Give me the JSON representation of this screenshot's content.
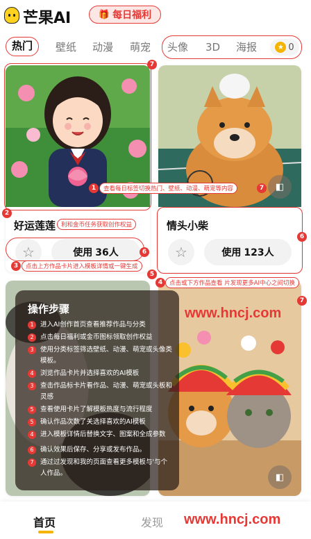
{
  "header": {
    "app_name": "芒果AI",
    "daily_label": "每日福利"
  },
  "tabs": [
    "热门",
    "壁纸",
    "动漫",
    "萌宠",
    "头像",
    "3D",
    "海报"
  ],
  "coin_count": "0",
  "cards": [
    {
      "title": "好运莲莲",
      "use_label": "使用",
      "use_count": "36人"
    },
    {
      "title": "情头小柴",
      "use_label": "使用",
      "use_count": "123人"
    }
  ],
  "tips": {
    "t1": "查看每日标签切换热门、壁纸、动漫、萌宠等内容",
    "t2": "利和金币任务获取创作权益",
    "t3": "点击上方作品卡片进入模板详情或一键生成",
    "t4": "点击或下方作品查看  片发现更多AI中心之间切换"
  },
  "badges": {
    "b1": "1",
    "b2": "2",
    "b3": "3",
    "b4": "4",
    "b5": "5",
    "b6": "6",
    "b7": "7"
  },
  "steps": {
    "title": "操作步骤",
    "items": [
      {
        "n": "1",
        "text": "进入AI创作首页查看推荐作品与分类"
      },
      {
        "n": "2",
        "text": "点击每日福利或金币图标领取创作权益"
      },
      {
        "n": "3",
        "text": "使用分类标签筛选壁纸、动漫、萌宠或头像类模板。"
      },
      {
        "n": "4",
        "text": "浏览作品卡片并选择喜欢的AI模板"
      },
      {
        "n": "3",
        "text": "查击作品标卡片看作品、动漫、萌宠或头板和灵感"
      },
      {
        "n": "5",
        "text": "查看使用卡片了解模板热度与流行程度"
      },
      {
        "n": "5",
        "text": "确认作品次数了关选择喜欢的AI模板"
      },
      {
        "n": "4",
        "text": "进入模板详情后替换文字、图案和全成参数"
      },
      {
        "n": "6",
        "text": "确认效果后保存、分享或发布作品。"
      },
      {
        "n": "7",
        "text": "通过过发现和我的页面查看更多模板与'与个人作品。"
      }
    ]
  },
  "watermark": "www.hncj.com",
  "bottom_nav": {
    "home": "首页",
    "discover": "发现"
  },
  "colors": {
    "accent": "#e53935",
    "brand_yellow": "#f5b400"
  }
}
